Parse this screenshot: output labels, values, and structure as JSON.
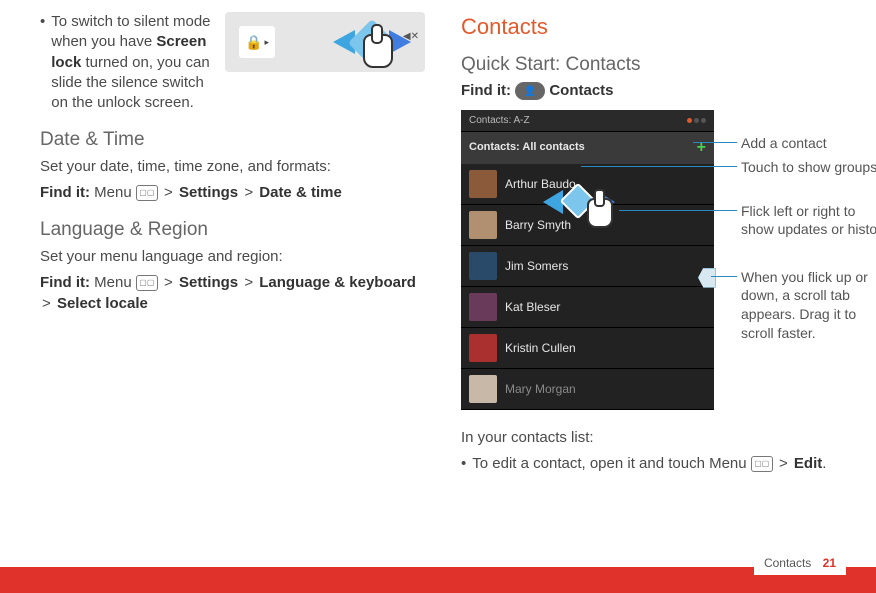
{
  "left": {
    "silent_bullet_pre": "To switch to silent mode when you have ",
    "screen_lock": "Screen lock",
    "silent_bullet_post": " turned on, you can slide the silence switch on the unlock screen.",
    "date_time_heading": "Date & Time",
    "date_time_body": "Set your date, time, time zone, and formats:",
    "find_it": "Find it:",
    "menu_label": "Menu",
    "settings": "Settings",
    "date_time_item": "Date & time",
    "lang_heading": "Language & Region",
    "lang_body": "Set your menu language and region:",
    "lang_keyboard": "Language & keyboard",
    "select_locale": "Select locale"
  },
  "right": {
    "chapter": "Contacts",
    "quick_start": "Quick Start: Contacts",
    "find_it": "Find it:",
    "contacts_label": "Contacts",
    "statusbar": "Contacts: A-Z",
    "header": "Contacts: All contacts",
    "rows": [
      "Arthur Baudo",
      "Barry Smyth",
      "Jim Somers",
      "Kat Bleser",
      "Kristin Cullen",
      "Mary Morgan"
    ],
    "callout1": "Add a contact",
    "callout2": "Touch to show groups",
    "callout3": "Flick left or right to show updates or history",
    "callout4": "When you flick up or down, a scroll tab appears. Drag it to scroll faster.",
    "in_list": "In your contacts list:",
    "edit_bullet_pre": "To edit a contact, open it and touch Menu ",
    "edit": "Edit",
    "period": "."
  },
  "footer": {
    "section": "Contacts",
    "page": "21"
  },
  "glyphs": {
    "gt": ">",
    "bullet": "•",
    "menu_squares": "▢▢",
    "lock": "🔒",
    "tri_r": "▸",
    "mute": "◀✕",
    "person": "👤"
  }
}
